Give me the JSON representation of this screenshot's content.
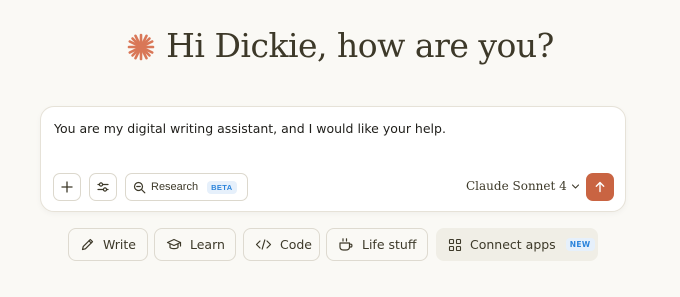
{
  "greeting": {
    "text": "Hi Dickie, how are you?"
  },
  "composer": {
    "prompt_value": "You are my digital writing assistant, and I would like your help.",
    "research_label": "Research",
    "research_badge": "BETA",
    "model_label": "Claude Sonnet 4"
  },
  "chips": [
    {
      "label": "Write",
      "icon": "pencil-icon"
    },
    {
      "label": "Learn",
      "icon": "graduation-cap-icon"
    },
    {
      "label": "Code",
      "icon": "code-icon"
    },
    {
      "label": "Life stuff",
      "icon": "coffee-cup-icon"
    },
    {
      "label": "Connect apps",
      "icon": "apps-grid-icon",
      "badge": "NEW"
    }
  ],
  "colors": {
    "accent": "#c96442",
    "background": "#faf9f5",
    "badge_blue": "#2c84db"
  }
}
